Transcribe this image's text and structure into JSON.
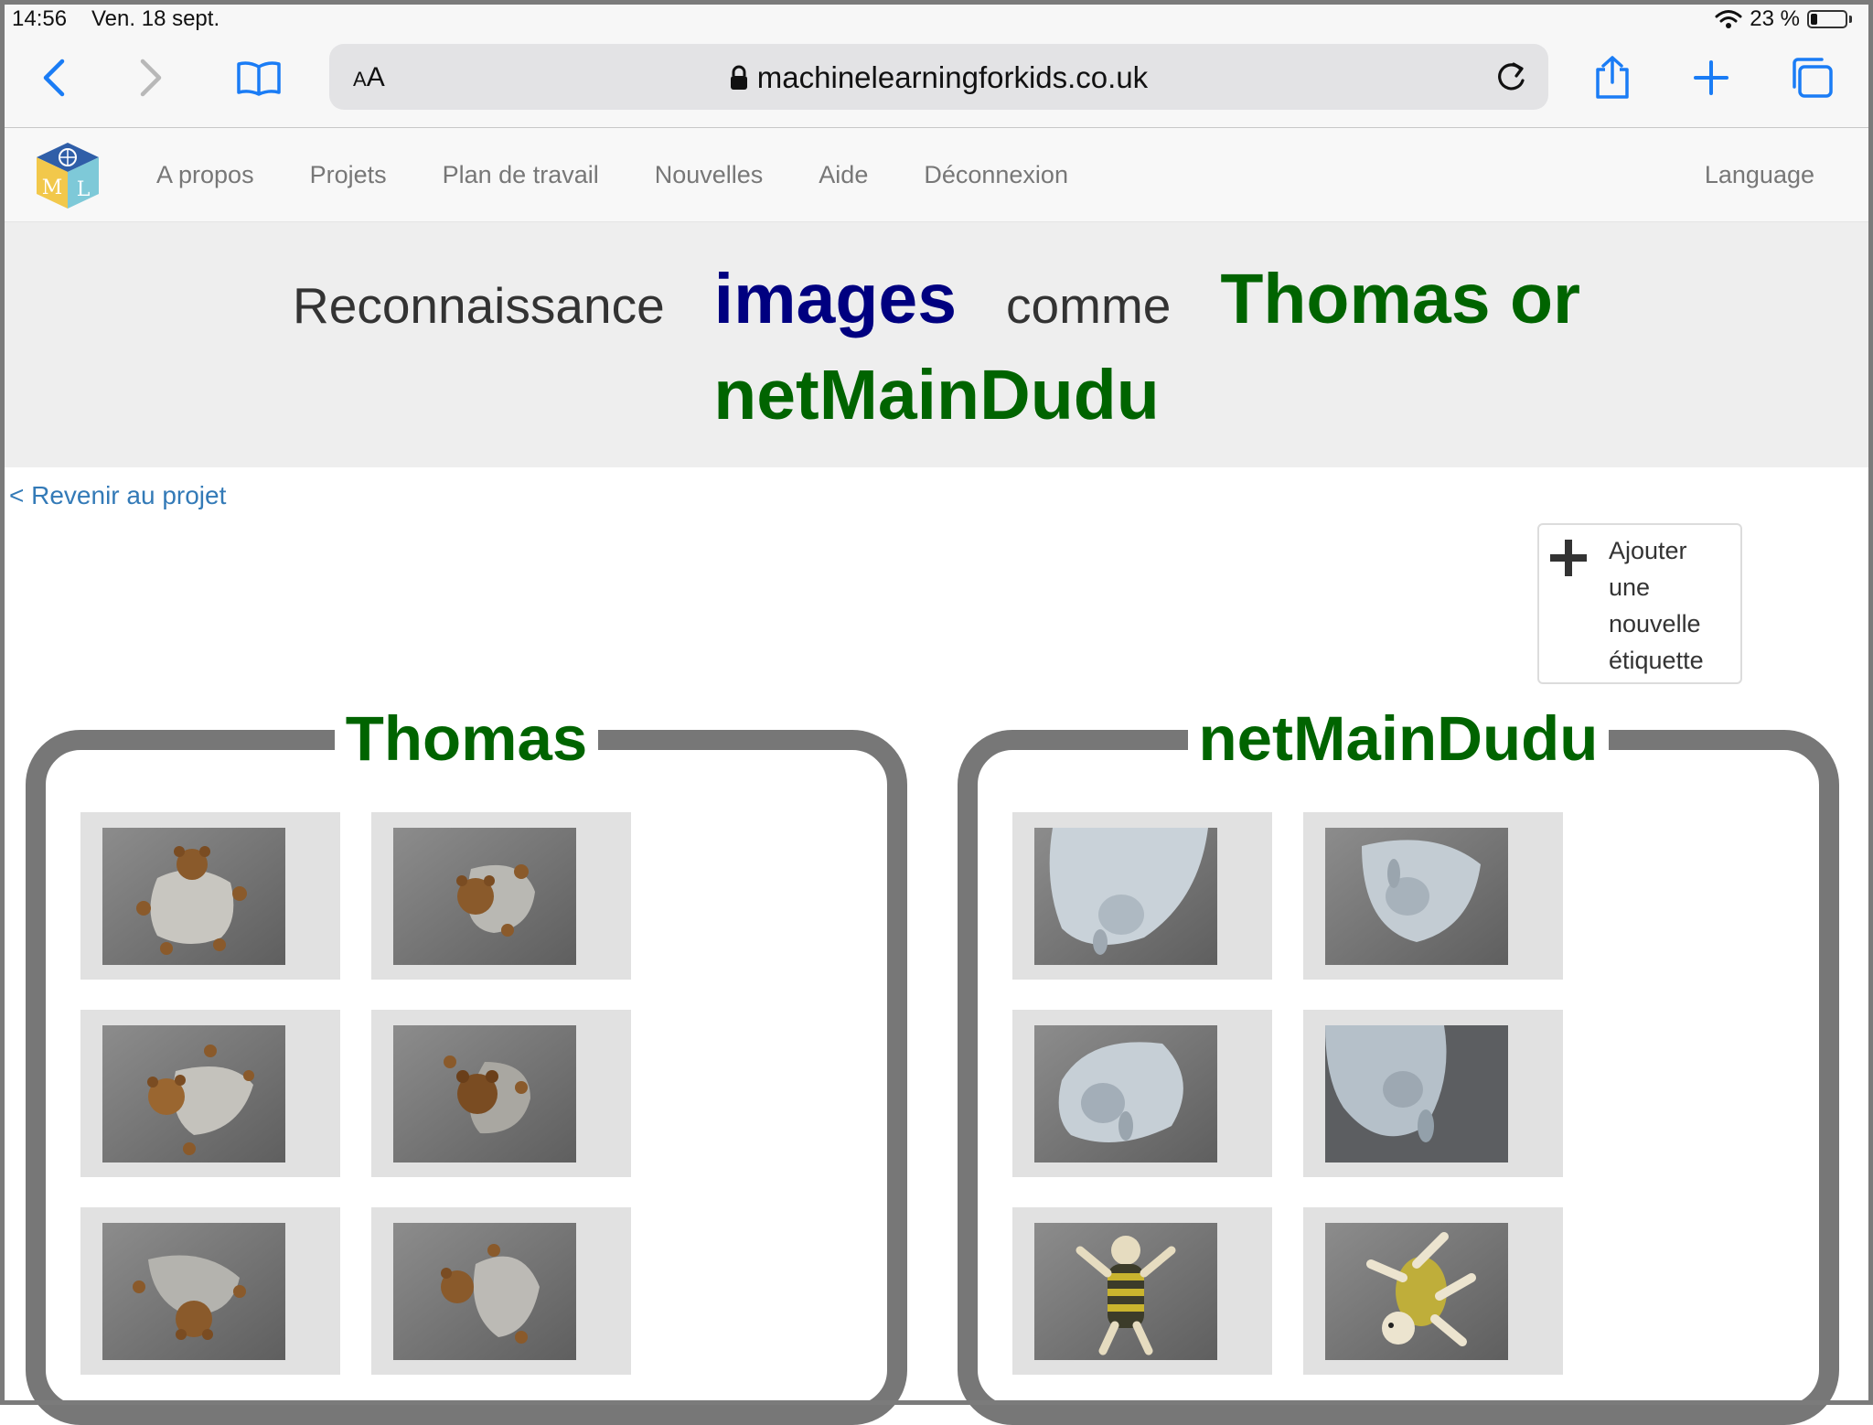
{
  "status_bar": {
    "time": "14:56",
    "date": "Ven. 18 sept.",
    "battery": "23 %"
  },
  "browser": {
    "url": "machinelearningforkids.co.uk",
    "text_size_label": "AA"
  },
  "site_nav": {
    "logo_letters": "ML",
    "links": [
      "A propos",
      "Projets",
      "Plan de travail",
      "Nouvelles",
      "Aide",
      "Déconnexion"
    ],
    "language": "Language"
  },
  "header": {
    "prefix": "Reconnaissance",
    "type": "images",
    "middle": "comme",
    "name_part1": "Thomas or",
    "name_part2": "netMainDudu"
  },
  "back_link": "< Revenir au projet",
  "add_label_button": "Ajouter une nouvelle étiquette",
  "labels": [
    {
      "name": "Thomas",
      "images": [
        "teddy-bear-blanket",
        "teddy-bear-blanket",
        "teddy-bear-blanket",
        "teddy-bear-blanket",
        "teddy-bear-blanket",
        "teddy-bear-blanket"
      ]
    },
    {
      "name": "netMainDudu",
      "images": [
        "blue-bunny-blanket",
        "blue-bunny-blanket",
        "blue-bunny-blanket",
        "blue-bunny-blanket",
        "striped-plush-toy",
        "yellow-plush-toy"
      ]
    }
  ],
  "colors": {
    "label_green": "#006400",
    "type_blue": "#000080",
    "link_blue": "#337ab7",
    "ios_blue": "#1a7cf5",
    "box_border": "#777777"
  }
}
